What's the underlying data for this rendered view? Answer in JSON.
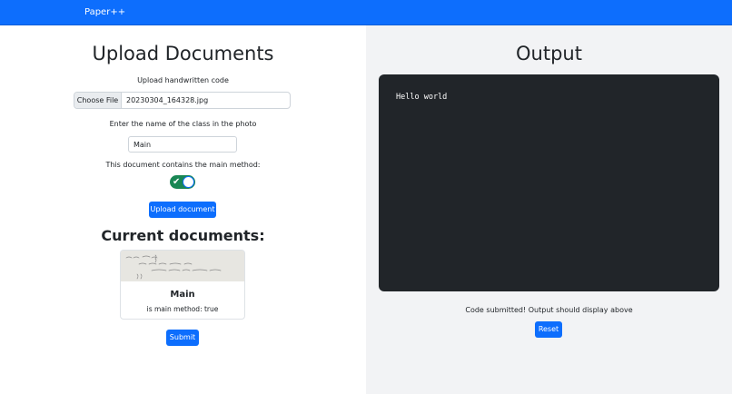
{
  "app": {
    "brand": "Paper++"
  },
  "upload": {
    "title": "Upload Documents",
    "file_label": "Upload handwritten code",
    "choose_file_label": "Choose File",
    "file_name": "20230304_164328.jpg",
    "class_name_label": "Enter the name of the class in the photo",
    "class_name_value": "Main",
    "main_method_label": "This document contains the main method:",
    "main_method_toggle": true,
    "upload_button": "Upload document"
  },
  "documents": {
    "title": "Current documents:",
    "items": [
      {
        "title": "Main",
        "text": "is main method: true"
      }
    ]
  },
  "submit_button": "Submit",
  "output": {
    "title": "Output",
    "console_text": "Hello world",
    "status": "Code submitted! Output should display above",
    "reset_button": "Reset"
  },
  "colors": {
    "primary": "#0d6efd",
    "toggle_on": "#198754",
    "console_bg": "#212529",
    "right_bg": "#f2f3f5"
  }
}
